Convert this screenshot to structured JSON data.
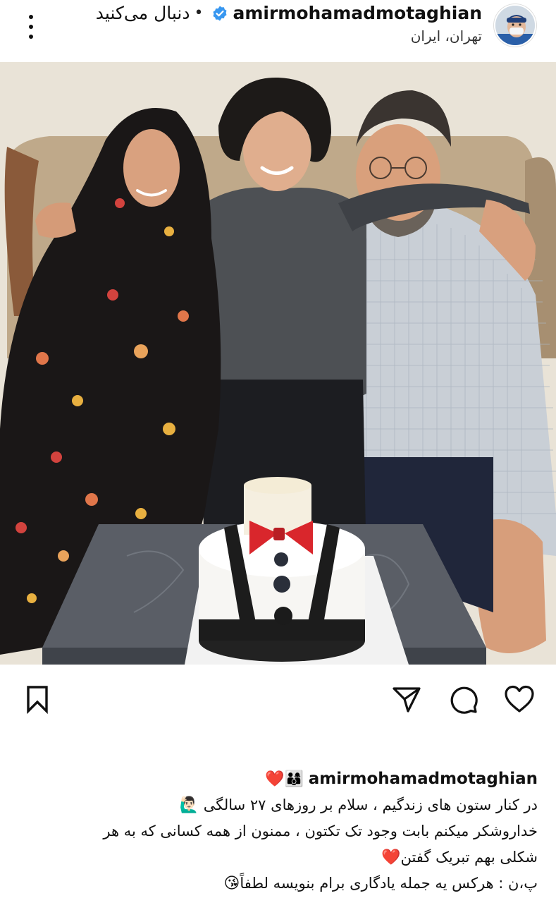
{
  "header": {
    "username": "amirmohamadmotaghian",
    "separator": "•",
    "follow_label": "دنبال می‌کنید",
    "location": "تهران، ایران"
  },
  "icons": {
    "menu": "more-vertical-icon",
    "verified": "verified-badge-icon",
    "bookmark": "bookmark-icon",
    "share": "send-icon",
    "comment": "comment-icon",
    "like": "heart-icon"
  },
  "colors": {
    "verified_blue": "#3897f0",
    "heart_red": "#e0242b"
  },
  "caption": {
    "username": "amirmohamadmotaghian",
    "leading_emojis": "👨‍👩‍👦❤️",
    "line1": "در کنار ستون های زندگیم ، سلام بر روزهای ۲۷ سالگی",
    "line1_emoji": "🙋🏻‍♂️",
    "line2": "خداروشکر میکنم بابت وجود تک تکتون ، ممنون از همه کسانی که به هر",
    "line3": "شکلی بهم تبریک گفتن",
    "line3_emoji": "❤️",
    "line4": "پ،ن : هرکس یه جمله یادگاری برام بنویسه لطفاً",
    "line4_emoji": "😘"
  }
}
